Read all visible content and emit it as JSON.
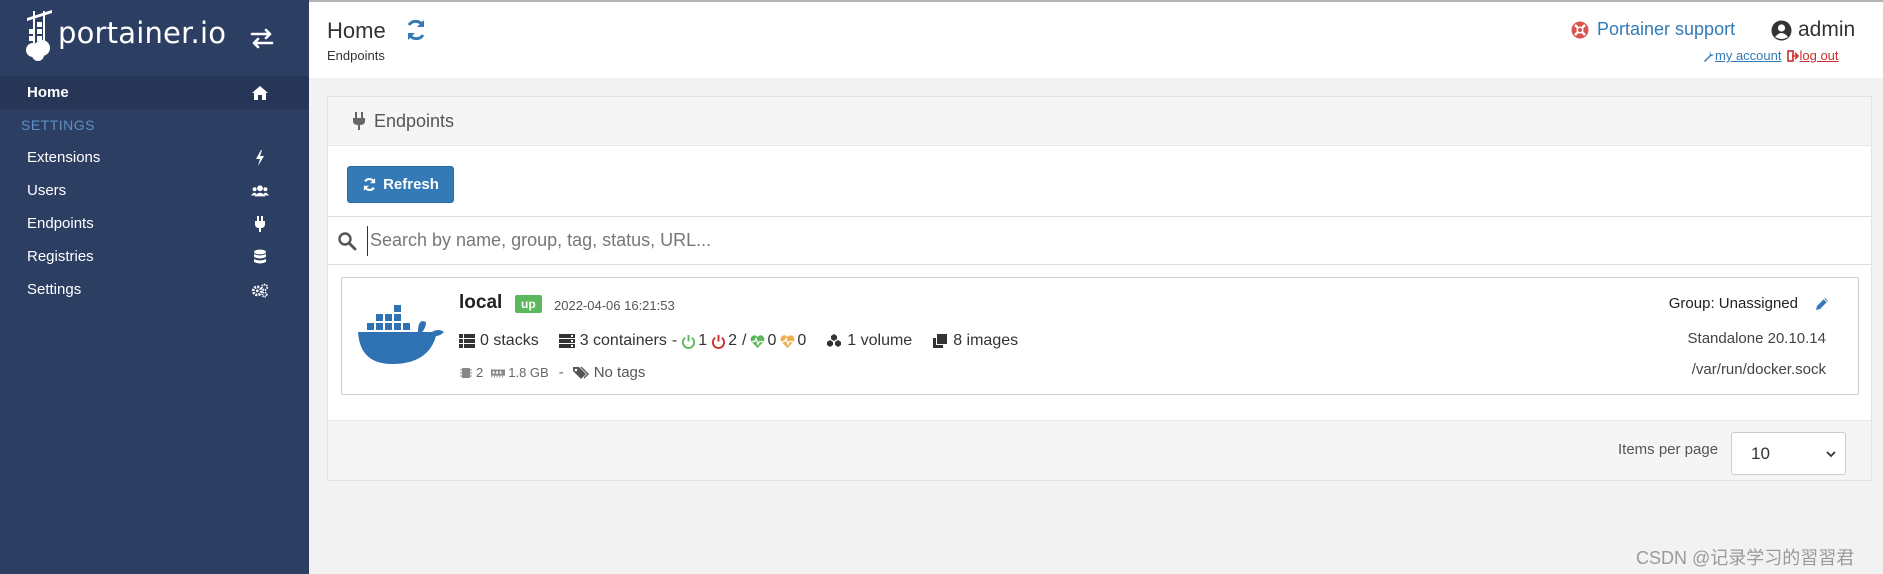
{
  "brand": {
    "name": "portainer.io"
  },
  "sidebar": {
    "home": {
      "label": "Home",
      "icon": "home-icon"
    },
    "section_label": "SETTINGS",
    "items": [
      {
        "label": "Extensions",
        "icon": "bolt-icon"
      },
      {
        "label": "Users",
        "icon": "users-icon"
      },
      {
        "label": "Endpoints",
        "icon": "plug-icon"
      },
      {
        "label": "Registries",
        "icon": "database-icon"
      },
      {
        "label": "Settings",
        "icon": "cogs-icon"
      }
    ]
  },
  "header": {
    "title": "Home",
    "breadcrumb": "Endpoints",
    "support_label": "Portainer support",
    "username": "admin",
    "my_account": "my account",
    "log_out": "log out"
  },
  "panel": {
    "title": "Endpoints",
    "refresh_label": "Refresh",
    "search_placeholder": "Search by name, group, tag, status, URL..."
  },
  "endpoint": {
    "name": "local",
    "status": "up",
    "timestamp": "2022-04-06 16:21:53",
    "stacks": "0 stacks",
    "containers": "3 containers",
    "dash": "-",
    "running": "1",
    "stopped": "2",
    "slash": "/",
    "healthy": "0",
    "unhealthy": "0",
    "volumes": "1 volume",
    "images": "8 images",
    "cpu": "2",
    "memory": "1.8 GB",
    "tags": "No tags",
    "group": "Group: Unassigned",
    "version": "Standalone 20.10.14",
    "url": "/var/run/docker.sock"
  },
  "pagination": {
    "items_per_page_label": "Items per page",
    "items_per_page_value": "10"
  },
  "watermark": "CSDN @记录学习的習習君",
  "colors": {
    "sidebar_bg": "#2d3e63",
    "primary": "#337ab7",
    "status_up": "#5cb85c",
    "danger": "#c9302c",
    "docker_blue": "#2f72b4"
  }
}
